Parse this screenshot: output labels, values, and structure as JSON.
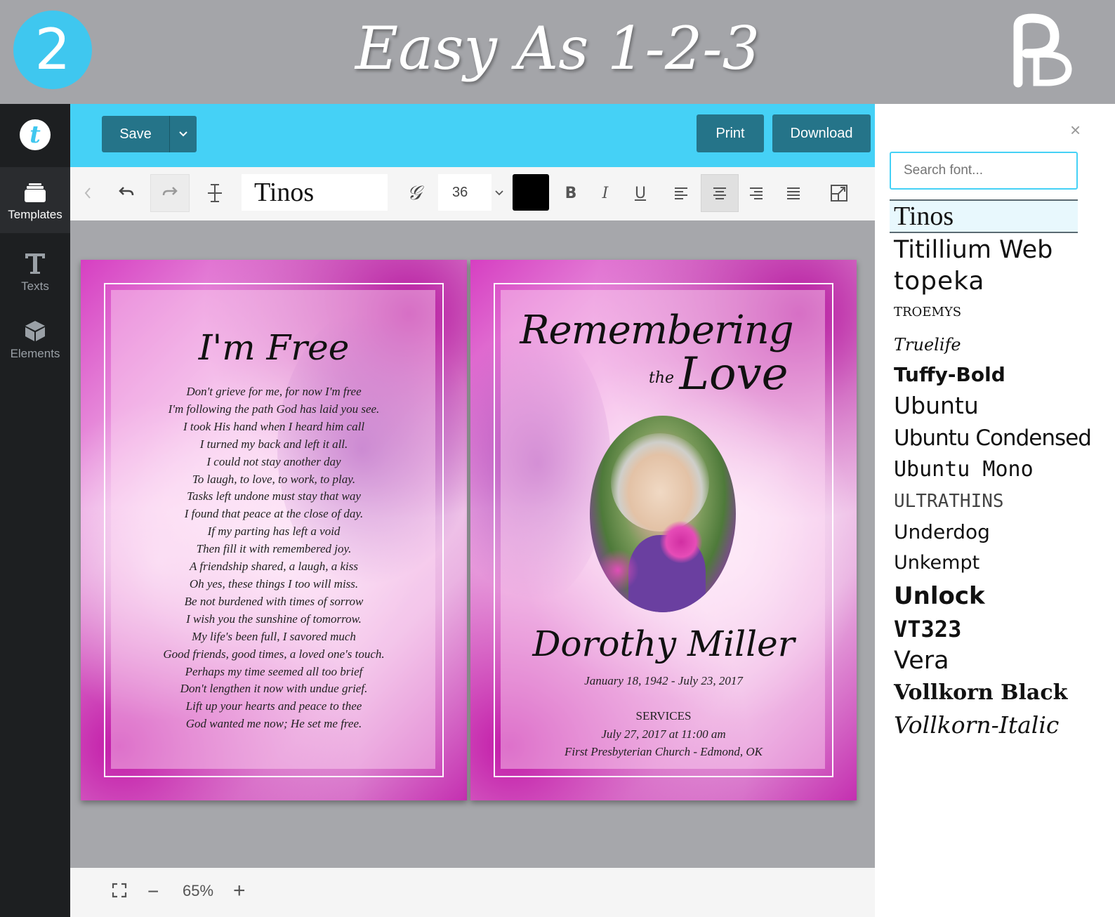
{
  "banner": {
    "step_number": "2",
    "title": "Easy As 1-2-3",
    "logo_letters": "PD",
    "badge_color": "#3fc7ef"
  },
  "sidebar": {
    "logo_letter": "t",
    "items": [
      {
        "label": "Templates",
        "icon": "layers-icon",
        "active": true
      },
      {
        "label": "Texts",
        "icon": "text-t-icon",
        "active": false
      },
      {
        "label": "Elements",
        "icon": "cube-icon",
        "active": false
      }
    ]
  },
  "topbar": {
    "save_label": "Save",
    "print_label": "Print",
    "download_label": "Download",
    "bar_color": "#45d1f6",
    "button_color": "#257489"
  },
  "toolbar": {
    "font_name": "Tinos",
    "font_size": "36",
    "text_color": "#000000",
    "bold": "B",
    "italic": "I",
    "underline": "U"
  },
  "document": {
    "left_page": {
      "title": "I'm Free",
      "poem": [
        "Don't grieve for me, for now I'm free",
        "I'm following the path God has laid you see.",
        "I took His hand when I heard him call",
        "I turned my back and left it all.",
        "I could not stay another day",
        "To laugh, to love, to work, to play.",
        "Tasks left undone must stay that way",
        "I found that peace at the close of day.",
        "If my parting has left a void",
        "Then fill it with remembered joy.",
        "A friendship shared, a laugh, a kiss",
        "Oh yes, these things I too will miss.",
        "Be not burdened with times of sorrow",
        "I wish you the sunshine of tomorrow.",
        "My life's been full, I savored much",
        "Good friends, good times, a loved one's touch.",
        "Perhaps my time seemed all too brief",
        "Don't lengthen it now with undue grief.",
        "Lift up your hearts and peace to thee",
        "God wanted me now; He set me free."
      ]
    },
    "right_page": {
      "heading_line1": "Remembering",
      "heading_the": "the",
      "heading_line2": "Love",
      "name": "Dorothy Miller",
      "dates": "January 18, 1942 - July 23, 2017",
      "services_label": "SERVICES",
      "service_time": "July 27, 2017 at 11:00 am",
      "service_place": "First Presbyterian Church - Edmond, OK"
    }
  },
  "zoom": {
    "level": "65%"
  },
  "font_panel": {
    "search_placeholder": "Search font...",
    "fonts": [
      {
        "name": "Tinos",
        "selected": true
      },
      {
        "name": "Titillium Web"
      },
      {
        "name": "topeka"
      },
      {
        "name": "TROEMYS"
      },
      {
        "name": "Truelife"
      },
      {
        "name": "Tuffy-Bold"
      },
      {
        "name": "Ubuntu"
      },
      {
        "name": "Ubuntu Condensed"
      },
      {
        "name": "Ubuntu Mono"
      },
      {
        "name": "ULTRATHINS"
      },
      {
        "name": "Underdog"
      },
      {
        "name": "Unkempt"
      },
      {
        "name": "Unlock"
      },
      {
        "name": "VT323"
      },
      {
        "name": "Vera"
      },
      {
        "name": "Vollkorn Black"
      },
      {
        "name": "Vollkorn-Italic"
      }
    ]
  }
}
